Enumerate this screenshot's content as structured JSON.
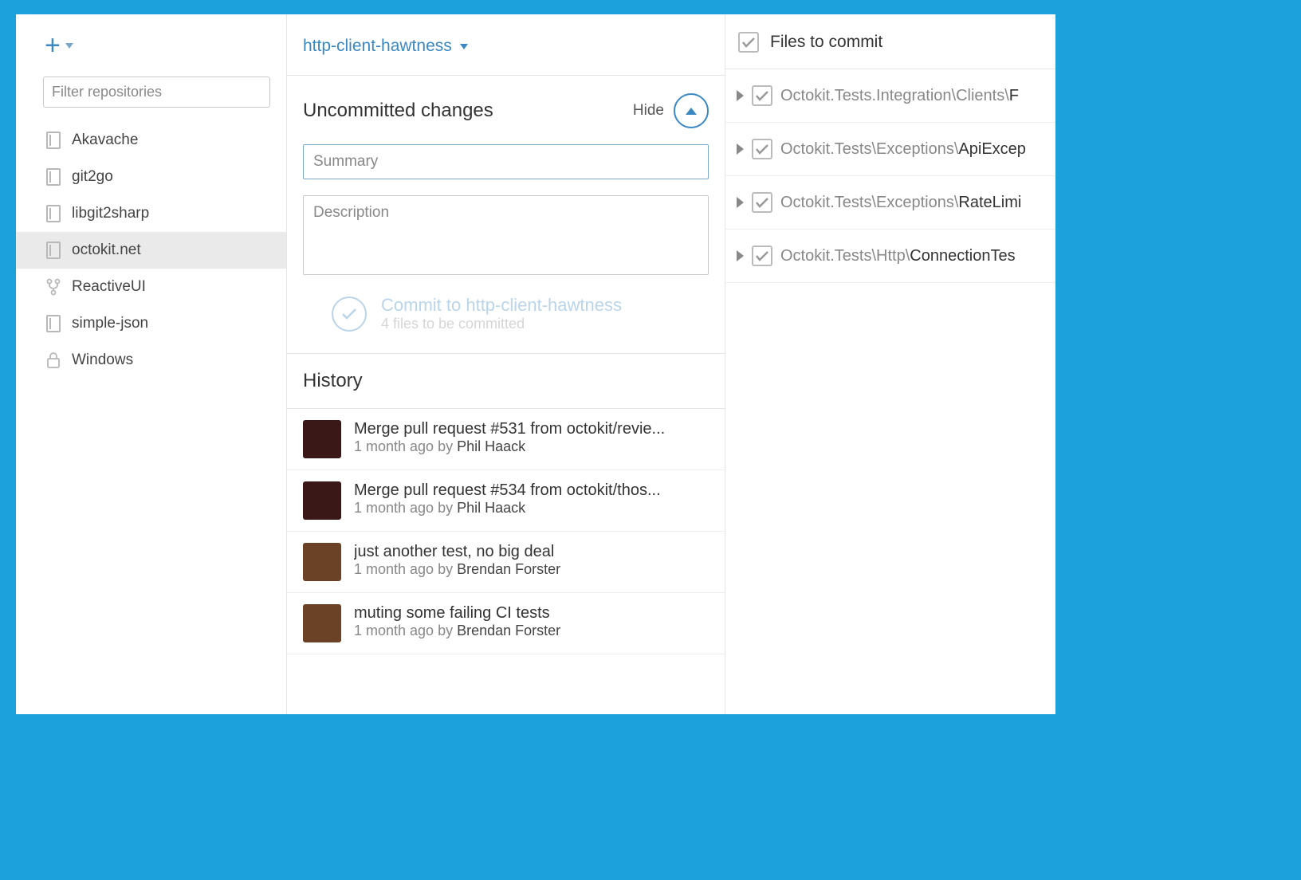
{
  "sidebar": {
    "filter_placeholder": "Filter repositories",
    "repos": [
      {
        "name": "Akavache",
        "icon": "book"
      },
      {
        "name": "git2go",
        "icon": "book"
      },
      {
        "name": "libgit2sharp",
        "icon": "book"
      },
      {
        "name": "octokit.net",
        "icon": "book",
        "selected": true
      },
      {
        "name": "ReactiveUI",
        "icon": "fork"
      },
      {
        "name": "simple-json",
        "icon": "book"
      },
      {
        "name": "Windows",
        "icon": "lock"
      }
    ]
  },
  "branch": "http-client-hawtness",
  "changes": {
    "title": "Uncommitted changes",
    "hide_label": "Hide",
    "summary_placeholder": "Summary",
    "description_placeholder": "Description",
    "commit_label": "Commit to http-client-hawtness",
    "commit_sub": "4 files to be committed"
  },
  "history": {
    "title": "History",
    "items": [
      {
        "msg": "Merge pull request #531 from octokit/revie...",
        "ago": "1 month ago",
        "by": "by ",
        "author": "Phil Haack",
        "avatar": "ph"
      },
      {
        "msg": "Merge pull request #534 from octokit/thos...",
        "ago": "1 month ago",
        "by": "by ",
        "author": "Phil Haack",
        "avatar": "ph"
      },
      {
        "msg": "just another test, no big deal",
        "ago": "1 month ago",
        "by": "by ",
        "author": "Brendan Forster",
        "avatar": "bf"
      },
      {
        "msg": "muting some failing CI tests",
        "ago": "1 month ago",
        "by": "by ",
        "author": "Brendan Forster",
        "avatar": "bf"
      }
    ]
  },
  "files": {
    "header": "Files to commit",
    "items": [
      {
        "dir": "Octokit.Tests.Integration\\Clients\\",
        "leaf": "F"
      },
      {
        "dir": "Octokit.Tests\\Exceptions\\",
        "leaf": "ApiExcep"
      },
      {
        "dir": "Octokit.Tests\\Exceptions\\",
        "leaf": "RateLimi"
      },
      {
        "dir": "Octokit.Tests\\Http\\",
        "leaf": "ConnectionTes"
      }
    ]
  }
}
